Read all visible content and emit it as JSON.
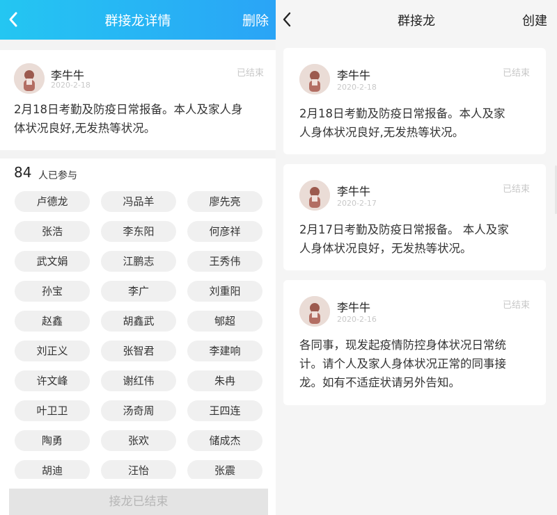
{
  "left": {
    "header": {
      "title": "群接龙详情",
      "delete_label": "删除"
    },
    "post": {
      "author": "李牛牛",
      "date": "2020-2-18",
      "status": "已结束",
      "content_line1": "2月18日考勤及防疫日常报备。本人及家人身",
      "content_line2": "体状况良好,无发热等状况。"
    },
    "participants": {
      "count": "84",
      "count_label": "人已参与",
      "names": [
        "卢德龙",
        "冯品羊",
        "廖先亮",
        "张浩",
        "李东阳",
        "何彦祥",
        "武文娟",
        "江鹏志",
        "王秀伟",
        "孙宝",
        "李广",
        "刘重阳",
        "赵鑫",
        "胡鑫武",
        "郇超",
        "刘正义",
        "张智君",
        "李建响",
        "许文峰",
        "谢红伟",
        "朱冉",
        "叶卫卫",
        "汤奇周",
        "王四连",
        "陶勇",
        "张欢",
        "储成杰",
        "胡迪",
        "汪怡",
        "张震"
      ]
    },
    "footer": {
      "end_label": "接龙已结束"
    }
  },
  "right": {
    "header": {
      "title": "群接龙",
      "create_label": "创建"
    },
    "posts": [
      {
        "author": "李牛牛",
        "date": "2020-2-18",
        "status": "已结束",
        "lines": [
          "2月18日考勤及防疫日常报备。本人及家",
          "人身体状况良好,无发热等状况。"
        ]
      },
      {
        "author": "李牛牛",
        "date": "2020-2-17",
        "status": "已结束",
        "lines": [
          "2月17日考勤及防疫日常报备。 本人及家",
          "人身体状况良好，无发热等状况。"
        ]
      },
      {
        "author": "李牛牛",
        "date": "2020-2-16",
        "status": "已结束",
        "lines": [
          "各同事，现发起疫情防控身体状况日常统",
          "计。请个人及家人身体状况正常的同事接",
          "龙。如有不适症状请另外告知。"
        ]
      }
    ]
  },
  "colors": {
    "header_start": "#24c6f2",
    "header_end": "#2aa4f6",
    "muted": "#c8c8c8"
  },
  "icons": {
    "back": "chevron-left-icon",
    "avatar": "user-avatar-icon"
  }
}
